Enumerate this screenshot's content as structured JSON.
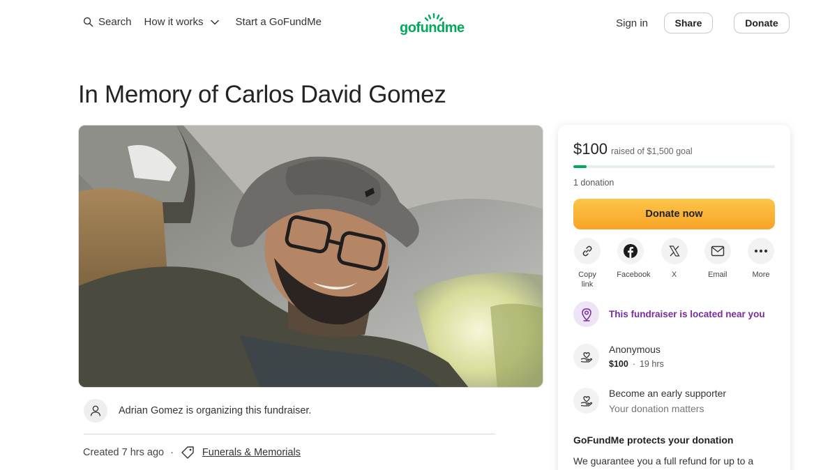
{
  "header": {
    "search_label": "Search",
    "how_it_works_label": "How it works",
    "start_label": "Start a GoFundMe",
    "logo_text": "gofundme",
    "sign_in_label": "Sign in",
    "share_label": "Share",
    "donate_label": "Donate"
  },
  "page": {
    "title": "In Memory of Carlos David Gomez"
  },
  "organizer": {
    "text": "Adrian Gomez is organizing this fundraiser."
  },
  "meta": {
    "created": "Created 7 hrs ago",
    "separator": "·",
    "category": "Funerals & Memorials"
  },
  "donation_card": {
    "raised_amount": "$100",
    "goal_text": "raised of $1,500 goal",
    "progress_fraction": 0.0667,
    "donation_count": "1 donation",
    "donate_now_label": "Donate now",
    "share_options": [
      {
        "label": "Copy link",
        "icon": "link-icon"
      },
      {
        "label": "Facebook",
        "icon": "facebook-icon"
      },
      {
        "label": "X",
        "icon": "x-icon"
      },
      {
        "label": "Email",
        "icon": "email-icon"
      },
      {
        "label": "More",
        "icon": "more-icon"
      }
    ],
    "near_text": "This fundraiser is located near you",
    "recent_donor": {
      "name": "Anonymous",
      "amount": "$100",
      "separator": "·",
      "time": "19 hrs"
    },
    "early_supporter": {
      "title": "Become an early supporter",
      "subtitle": "Your donation matters"
    },
    "protect_title": "GoFundMe protects your donation",
    "protect_body": "We guarantee you a full refund for up to a"
  },
  "colors": {
    "brand_green": "#02a95c",
    "donate_orange": "#f8a325",
    "near_purple": "#7a2c9e"
  }
}
